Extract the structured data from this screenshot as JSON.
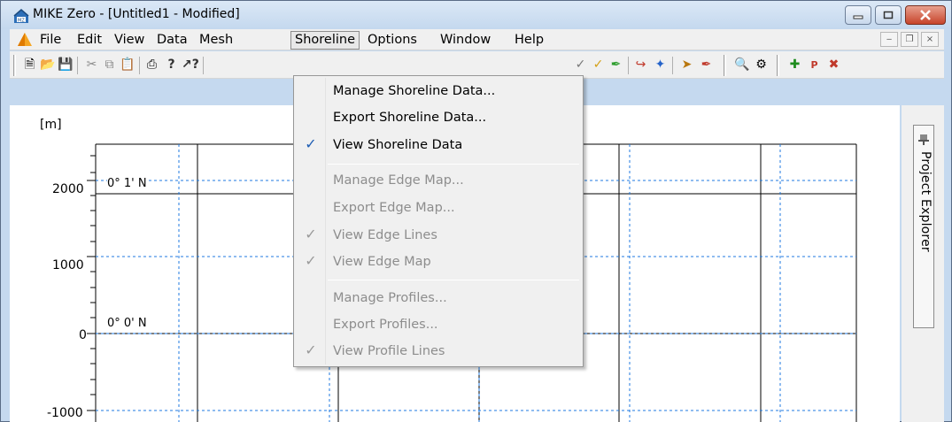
{
  "window": {
    "title": "MIKE Zero - [Untitled1 - Modified]",
    "caption_buttons": [
      "minimize",
      "maximize",
      "close"
    ]
  },
  "menubar": {
    "items": [
      {
        "label": "File"
      },
      {
        "label": "Edit"
      },
      {
        "label": "View"
      },
      {
        "label": "Data"
      },
      {
        "label": "Mesh"
      },
      {
        "label": "Shoreline",
        "open": true
      },
      {
        "label": "Options"
      },
      {
        "label": "Window"
      },
      {
        "label": "Help"
      }
    ],
    "mdi_buttons": [
      "minimize",
      "restore",
      "close"
    ]
  },
  "toolbar": {
    "icons": [
      "new-icon",
      "open-icon",
      "save-icon",
      "cut-icon",
      "copy-icon",
      "paste-icon",
      "print-icon",
      "help-icon",
      "context-help-icon",
      "edit-node-icon",
      "add-node-icon",
      "paint-icon",
      "route-icon",
      "interpolate-icon",
      "select-icon",
      "brush-icon",
      "find-icon",
      "settings-icon",
      "add-point-icon",
      "point-select-icon",
      "delete-point-icon"
    ]
  },
  "shoreline_menu": {
    "groups": [
      [
        {
          "label": "Manage Shoreline Data...",
          "enabled": true,
          "checked": false
        },
        {
          "label": "Export Shoreline Data...",
          "enabled": true,
          "checked": false
        },
        {
          "label": "View Shoreline Data",
          "enabled": true,
          "checked": true
        }
      ],
      [
        {
          "label": "Manage Edge Map...",
          "enabled": false,
          "checked": false
        },
        {
          "label": "Export Edge Map...",
          "enabled": false,
          "checked": false
        },
        {
          "label": "View Edge Lines",
          "enabled": false,
          "checked": true
        },
        {
          "label": "View Edge Map",
          "enabled": false,
          "checked": true
        }
      ],
      [
        {
          "label": "Manage Profiles...",
          "enabled": false,
          "checked": false
        },
        {
          "label": "Export Profiles...",
          "enabled": false,
          "checked": false
        },
        {
          "label": "View Profile Lines",
          "enabled": false,
          "checked": true
        }
      ]
    ]
  },
  "map": {
    "unit_label": "[m]",
    "y_ticks": [
      "2000",
      "1000",
      "0",
      "-1000"
    ],
    "lat_labels": [
      "0° 1' N",
      "0° 0' N"
    ]
  },
  "project_explorer": {
    "label": "Project Explorer"
  }
}
